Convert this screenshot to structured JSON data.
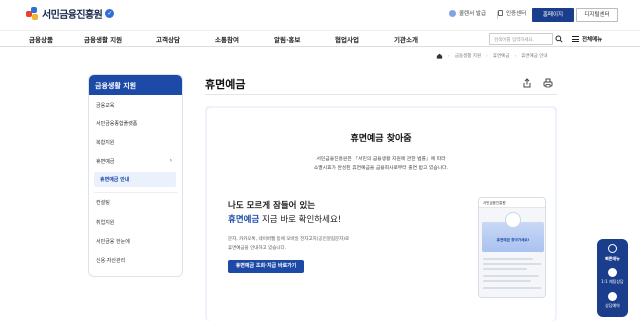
{
  "header": {
    "logo_text": "서민금융진흥원",
    "util_links": [
      "콜렌서 발급",
      "인증센터"
    ],
    "home_btn": "홈페이지",
    "digital_btn": "디지털센터",
    "nav": [
      "금융상품",
      "금융생활 지원",
      "고객상담",
      "소통참여",
      "알림·홍보",
      "협업사업",
      "기관소개"
    ],
    "search_placeholder": "검색어를 입력하세요.",
    "all_menu": "전체메뉴"
  },
  "breadcrumb": [
    "금융생활 지원",
    "휴면예금",
    "휴면예금 안내"
  ],
  "sidebar": {
    "title": "금융생활 지원",
    "items": [
      "금융교육",
      "서민금융종합플랫폼",
      "복합지원",
      "휴면예금",
      "휴면예금 안내",
      "컨설팅",
      "취업지원",
      "서민금융 한눈에",
      "신용·자산관리"
    ]
  },
  "page": {
    "title": "휴면예금",
    "section_title": "휴면예금 찾아줌",
    "section_desc": [
      "서민금융진흥원은 『서민의 금융생활 지원에 관한 법률』에 따라",
      "소멸시효가 완성된 휴면예금을 금융회사로부터 출연 받고 있습니다."
    ],
    "hero_line1": "나도 모르게 잠들어 있는",
    "hero_highlight": "휴면예금",
    "hero_line2_rest": " 지금 바로 확인하세요!",
    "hero_desc": [
      "문자, 카카오톡, 네이버웹 등에 모바일 전자고지(공인알림문자)로",
      "휴면예금을 안내하고 있습니다."
    ],
    "cta": "휴면예금 조회·지급 바로가기"
  },
  "phone": {
    "bar": "서민금융진흥원",
    "hero_text": "휴면예금 찾아가세요!"
  },
  "quick": {
    "title": "빠른메뉴",
    "items": [
      "1:1 채팅상담",
      "상담예약"
    ]
  },
  "colors": {
    "brand": "#1e4aa7",
    "brand_dark": "#1b3e8c",
    "panel_bg": "#eef3fb"
  }
}
